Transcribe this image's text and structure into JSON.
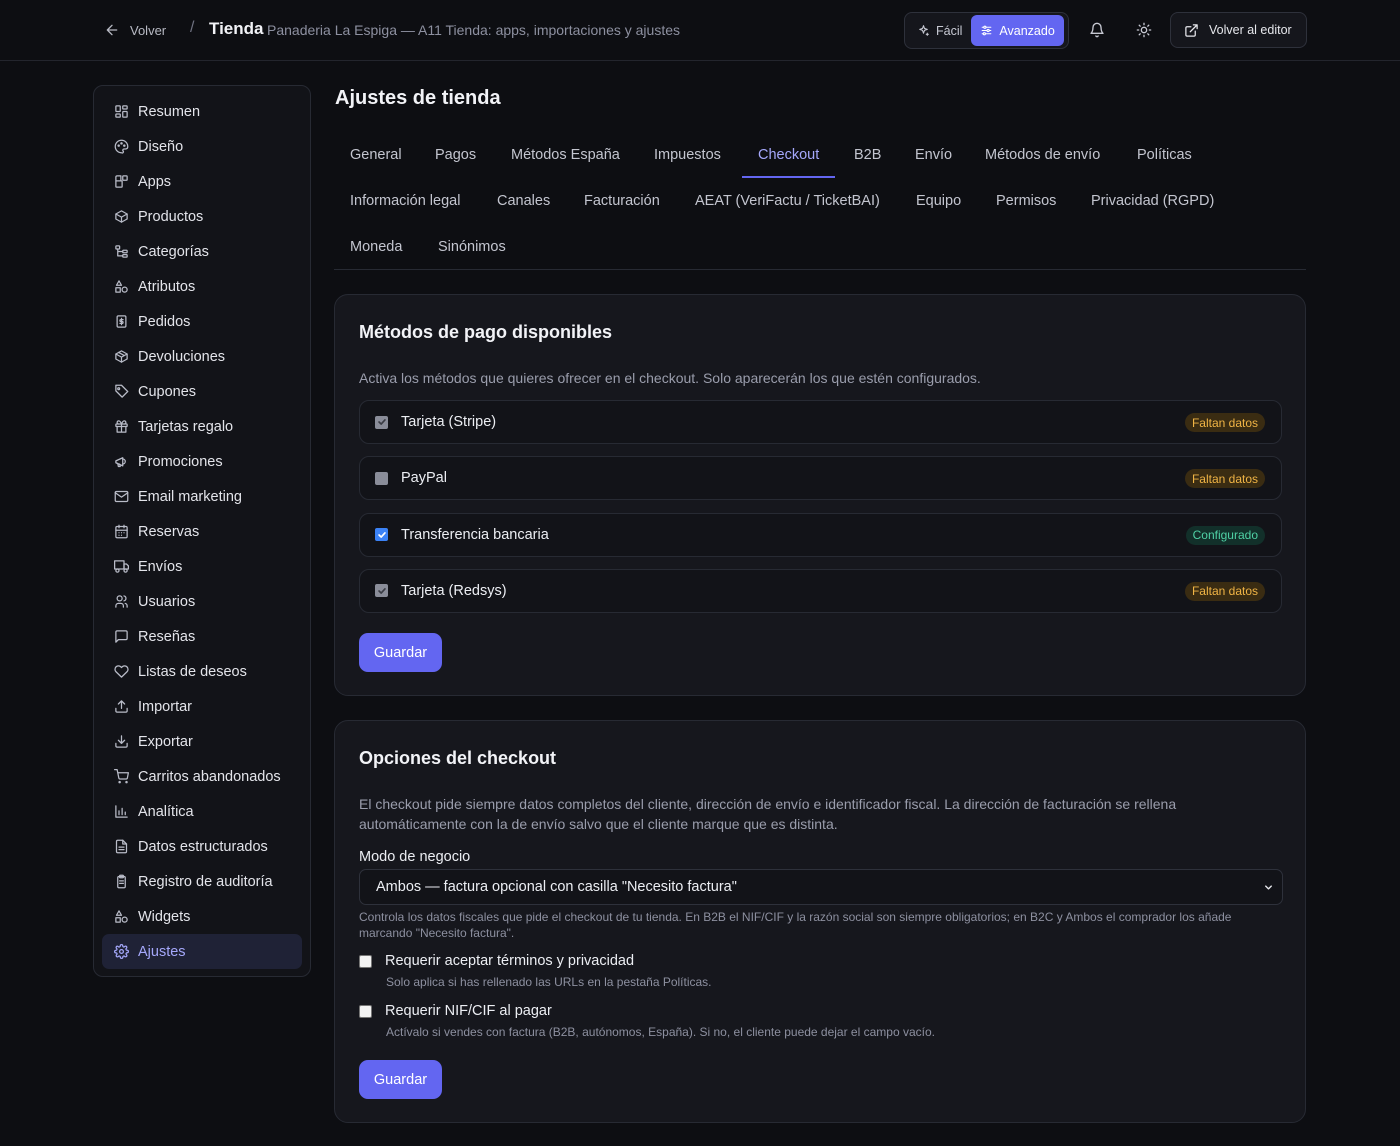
{
  "header": {
    "back_label": "Volver",
    "separator": "/",
    "title": "Tienda",
    "subtitle": "Panaderia La Espiga — A11 Tienda: apps, importaciones y ajustes",
    "mode_easy": "Fácil",
    "mode_advanced": "Avanzado",
    "editor_label": "Volver al editor"
  },
  "sidebar": {
    "items": [
      {
        "label": "Resumen",
        "icon": "dashboard-icon"
      },
      {
        "label": "Diseño",
        "icon": "palette-icon"
      },
      {
        "label": "Apps",
        "icon": "apps-icon"
      },
      {
        "label": "Productos",
        "icon": "box-icon"
      },
      {
        "label": "Categorías",
        "icon": "tree-icon"
      },
      {
        "label": "Atributos",
        "icon": "shapes-icon"
      },
      {
        "label": "Pedidos",
        "icon": "receipt-icon"
      },
      {
        "label": "Devoluciones",
        "icon": "package-icon"
      },
      {
        "label": "Cupones",
        "icon": "tag-icon"
      },
      {
        "label": "Tarjetas regalo",
        "icon": "gift-icon"
      },
      {
        "label": "Promociones",
        "icon": "megaphone-icon"
      },
      {
        "label": "Email marketing",
        "icon": "mail-icon"
      },
      {
        "label": "Reservas",
        "icon": "calendar-icon"
      },
      {
        "label": "Envíos",
        "icon": "truck-icon"
      },
      {
        "label": "Usuarios",
        "icon": "users-icon"
      },
      {
        "label": "Reseñas",
        "icon": "message-icon"
      },
      {
        "label": "Listas de deseos",
        "icon": "heart-icon"
      },
      {
        "label": "Importar",
        "icon": "upload-icon"
      },
      {
        "label": "Exportar",
        "icon": "download-icon"
      },
      {
        "label": "Carritos abandonados",
        "icon": "cart-icon"
      },
      {
        "label": "Analítica",
        "icon": "chart-icon"
      },
      {
        "label": "Datos estructurados",
        "icon": "document-icon"
      },
      {
        "label": "Registro de auditoría",
        "icon": "clipboard-icon"
      },
      {
        "label": "Widgets",
        "icon": "widgets-icon"
      },
      {
        "label": "Ajustes",
        "icon": "gear-icon",
        "active": true
      }
    ]
  },
  "main": {
    "page_title": "Ajustes de tienda",
    "tabs": [
      "General",
      "Pagos",
      "Métodos España",
      "Impuestos",
      "Checkout",
      "B2B",
      "Envío",
      "Métodos de envío",
      "Políticas",
      "Información legal",
      "Canales",
      "Facturación",
      "AEAT (VeriFactu / TicketBAI)",
      "Equipo",
      "Permisos",
      "Privacidad (RGPD)",
      "Moneda",
      "Sinónimos"
    ],
    "active_tab": "Checkout"
  },
  "payment_card": {
    "title": "Métodos de pago disponibles",
    "description": "Activa los métodos que quieres ofrecer en el checkout. Solo aparecerán los que estén configurados.",
    "methods": [
      {
        "label": "Tarjeta (Stripe)",
        "checked": true,
        "disabled": true,
        "status": "Faltan datos",
        "status_type": "warn"
      },
      {
        "label": "PayPal",
        "checked": false,
        "disabled": true,
        "status": "Faltan datos",
        "status_type": "warn"
      },
      {
        "label": "Transferencia bancaria",
        "checked": true,
        "disabled": false,
        "status": "Configurado",
        "status_type": "ok"
      },
      {
        "label": "Tarjeta (Redsys)",
        "checked": true,
        "disabled": true,
        "status": "Faltan datos",
        "status_type": "warn"
      }
    ],
    "save_label": "Guardar"
  },
  "checkout_card": {
    "title": "Opciones del checkout",
    "description_line1": "El checkout pide siempre datos completos del cliente, dirección de envío e identificador fiscal. La dirección de facturación se rellena",
    "description_line2": "automáticamente con la de envío salvo que el cliente marque que es distinta.",
    "business_mode_label": "Modo de negocio",
    "business_mode_value": "Ambos — factura opcional con casilla \"Necesito factura\"",
    "business_mode_help_line1": "Controla los datos fiscales que pide el checkout de tu tienda. En B2B el NIF/CIF y la razón social son siempre obligatorios; en B2C y Ambos el comprador los añade",
    "business_mode_help_line2": "marcando \"Necesito factura\".",
    "option_terms_label": "Requerir aceptar términos y privacidad",
    "option_terms_help": "Solo aplica si has rellenado las URLs en la pestaña Políticas.",
    "option_nif_label": "Requerir NIF/CIF al pagar",
    "option_nif_help": "Actívalo si vendes con factura (B2B, autónomos, España). Si no, el cliente puede dejar el campo vacío.",
    "save_label": "Guardar"
  },
  "colors": {
    "accent": "#6366f1",
    "warn": "#f0b445",
    "ok": "#4fd1a5",
    "background": "#0d0e12"
  }
}
